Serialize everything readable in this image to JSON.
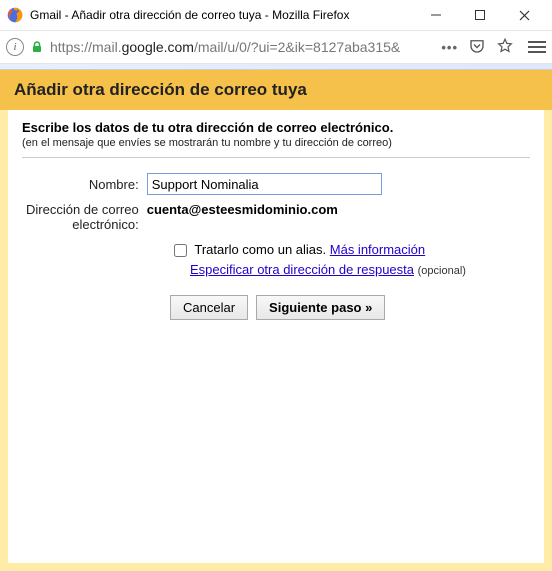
{
  "window": {
    "title": "Gmail - Añadir otra dirección de correo tuya - Mozilla Firefox"
  },
  "url": {
    "prefix": "https://mail.",
    "host": "google.com",
    "path": "/mail/u/0/?ui=2&ik=8127aba315&"
  },
  "header": {
    "title": "Añadir otra dirección de correo tuya"
  },
  "instructions": {
    "title": "Escribe los datos de tu otra dirección de correo electrónico.",
    "subtitle": "(en el mensaje que envíes se mostrarán tu nombre y tu dirección de correo)"
  },
  "form": {
    "name_label": "Nombre:",
    "name_value": "Support Nominalia",
    "email_label_line1": "Dirección de correo",
    "email_label_line2": "electrónico:",
    "email_value": "cuenta@esteesmidominio.com",
    "alias_label": "Tratarlo como un alias.",
    "more_info": "Más información",
    "reply_link": "Especificar otra dirección de respuesta",
    "optional": "(opcional)"
  },
  "buttons": {
    "cancel": "Cancelar",
    "next": "Siguiente paso »"
  }
}
